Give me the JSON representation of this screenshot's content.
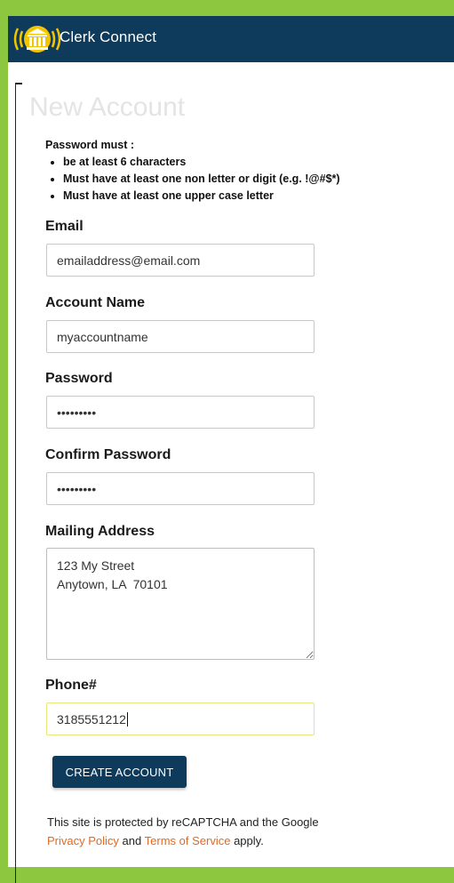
{
  "header": {
    "app_title": "Clerk Connect"
  },
  "page": {
    "title": "New Account"
  },
  "password_rules": {
    "heading": "Password must :",
    "items": [
      "be at least 6 characters",
      "Must have at least one non letter or digit (e.g. !@#$*)",
      "Must have at least one upper case letter"
    ]
  },
  "form": {
    "email": {
      "label": "Email",
      "value": "emailaddress@email.com"
    },
    "account_name": {
      "label": "Account Name",
      "value": "myaccountname"
    },
    "password": {
      "label": "Password",
      "value": "•••••••••"
    },
    "confirm_password": {
      "label": "Confirm Password",
      "value": "•••••••••"
    },
    "mailing_address": {
      "label": "Mailing Address",
      "value": "123 My Street\nAnytown, LA  70101"
    },
    "phone": {
      "label": "Phone#",
      "value": "3185551212"
    }
  },
  "submit": {
    "label": "CREATE ACCOUNT"
  },
  "recaptcha": {
    "text_before": "This site is protected by reCAPTCHA and the Google",
    "privacy_link": "Privacy Policy",
    "and": "and",
    "terms_link": "Terms of Service",
    "apply": "apply."
  },
  "colors": {
    "border_green": "#8dc63f",
    "header_navy": "#0e3a5c",
    "link_orange": "#e06a23",
    "logo_gold": "#f2c500"
  }
}
